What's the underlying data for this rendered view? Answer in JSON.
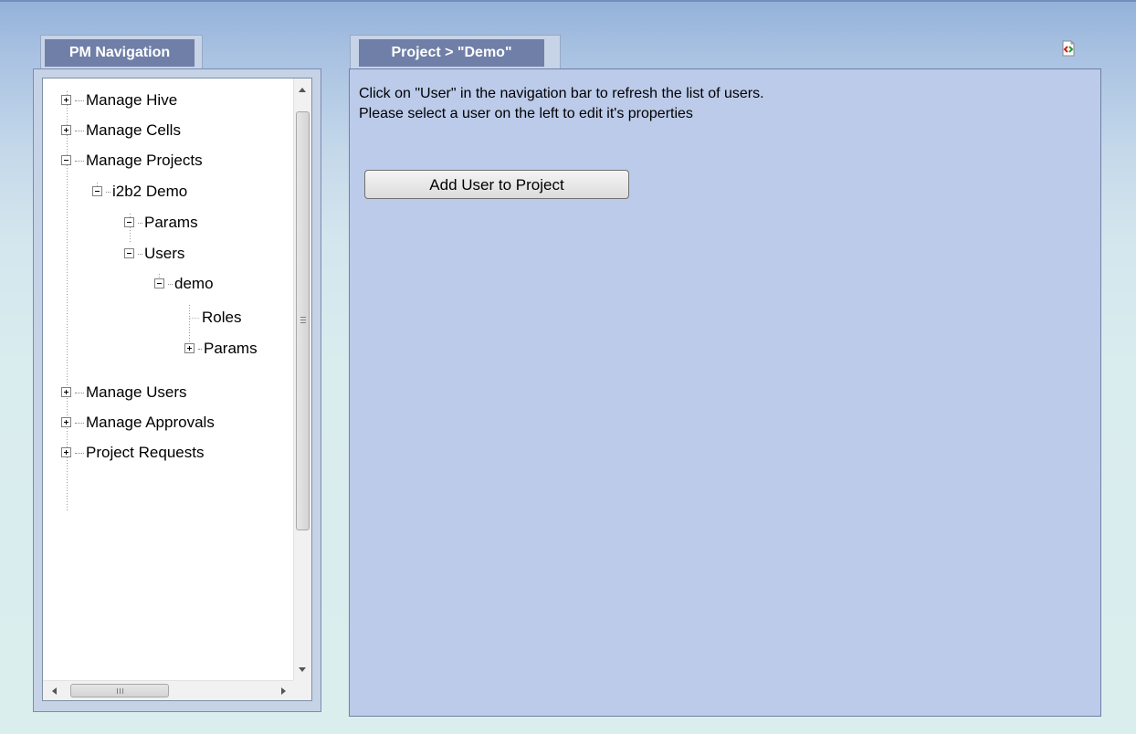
{
  "nav_panel": {
    "tab_label": "PM Navigation",
    "tree": [
      {
        "label": "Manage Hive",
        "state": "collapsed"
      },
      {
        "label": "Manage Cells",
        "state": "collapsed"
      },
      {
        "label": "Manage Projects",
        "state": "expanded"
      },
      {
        "label": "i2b2 Demo",
        "state": "expanded"
      },
      {
        "label": "Params",
        "state": "expanded"
      },
      {
        "label": "Users",
        "state": "expanded"
      },
      {
        "label": "demo",
        "state": "expanded"
      },
      {
        "label": "Roles",
        "state": "leaf"
      },
      {
        "label": "Params",
        "state": "collapsed"
      },
      {
        "label": "Manage Users",
        "state": "collapsed"
      },
      {
        "label": "Manage Approvals",
        "state": "collapsed"
      },
      {
        "label": "Project Requests",
        "state": "collapsed"
      }
    ]
  },
  "main_panel": {
    "tab_label": "Project > \"Demo\"",
    "message_line1": "Click on \"User\" in the navigation bar to refresh the list of users.",
    "message_line2": "Please select a user on the left to edit it's properties",
    "add_user_button": "Add User to Project",
    "corner_icon": "code-tag-icon"
  },
  "colors": {
    "tab_label_bg": "#6f7fa7",
    "panel_bg": "#bccbea",
    "nav_panel_bg": "#c6d2e6"
  }
}
